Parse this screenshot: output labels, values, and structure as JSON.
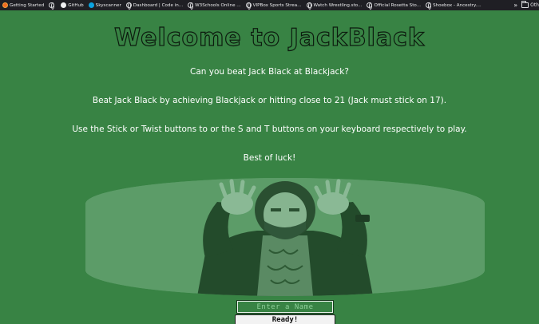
{
  "bookmarks": [
    {
      "label": "Getting Started",
      "icon": "firefox-icon"
    },
    {
      "label": "",
      "icon": "globe-icon"
    },
    {
      "label": "GitHub",
      "icon": "github-icon"
    },
    {
      "label": "Skyscanner",
      "icon": "skyscanner-icon"
    },
    {
      "label": "Dashboard | Code in...",
      "icon": "globe-icon"
    },
    {
      "label": "W3Schools Online ...",
      "icon": "globe-icon"
    },
    {
      "label": "VIPBox Sports Strea...",
      "icon": "globe-icon"
    },
    {
      "label": "Watch Wrestling.sto...",
      "icon": "globe-icon"
    },
    {
      "label": "Official Rosetta Sto...",
      "icon": "globe-icon"
    },
    {
      "label": "Shoebox - Ancestry....",
      "icon": "globe-icon"
    }
  ],
  "bookmarks_right": {
    "more": "»",
    "other": "Oth"
  },
  "page": {
    "title": "Welcome to JackBlack",
    "line1": "Can you beat Jack Black at Blackjack?",
    "line2": "Beat Jack Black by achieving Blackjack or hitting close to 21 (Jack must stick on 17).",
    "line3": "Use the Stick or Twist buttons to or the S and T buttons on your keyboard respectively to play.",
    "line4": "Best of luck!"
  },
  "form": {
    "name_placeholder": "Enter a Name",
    "ready_label": "Ready!"
  },
  "colors": {
    "background": "#388344",
    "title_outline": "#0c1a0e",
    "photo_tint": "#5c9c68"
  }
}
